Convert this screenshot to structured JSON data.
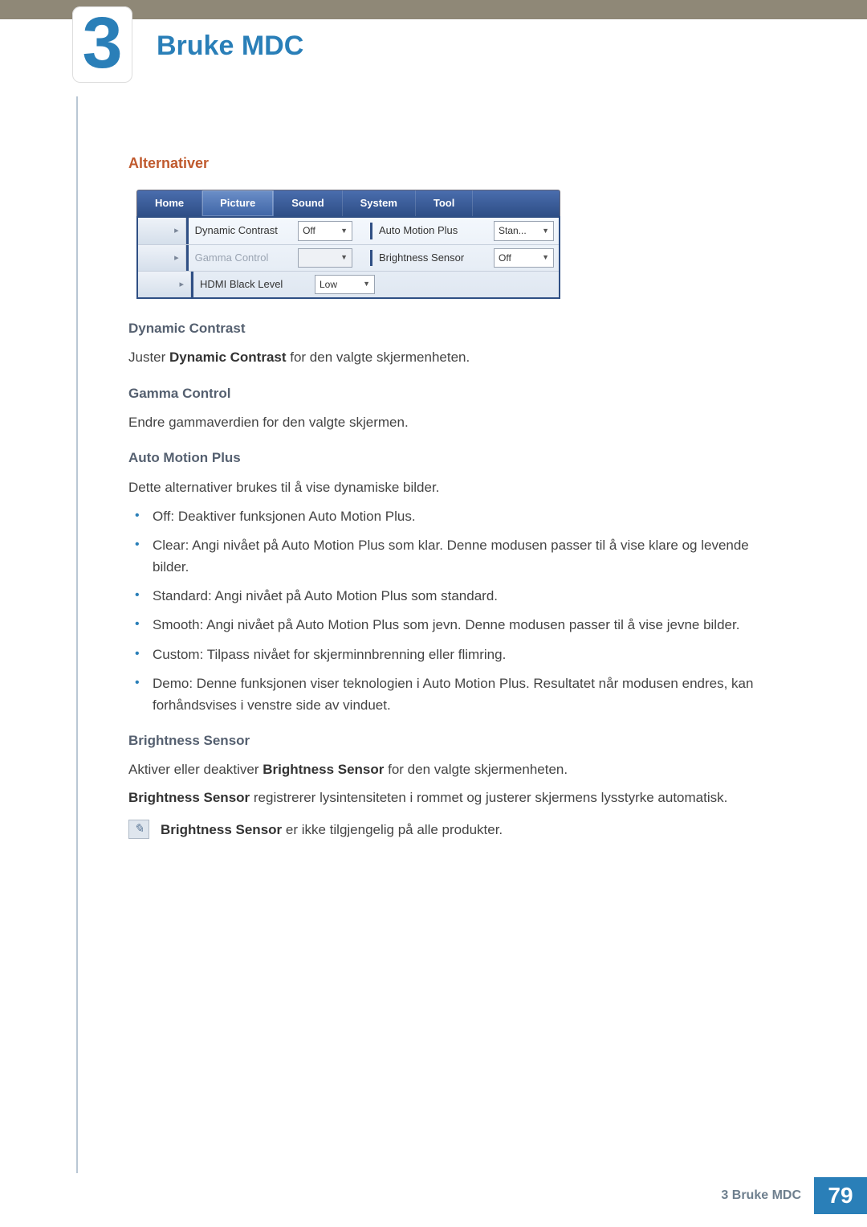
{
  "header": {
    "chapter_number": "3",
    "chapter_title": "Bruke MDC"
  },
  "section": {
    "title": "Alternativer"
  },
  "ui": {
    "tabs": [
      "Home",
      "Picture",
      "Sound",
      "System",
      "Tool"
    ],
    "active_tab": "Picture",
    "rows": [
      {
        "left_label": "Dynamic Contrast",
        "left_value": "Off",
        "left_disabled": false,
        "right_label": "Auto Motion Plus",
        "right_value": "Stan...",
        "right_disabled": false
      },
      {
        "left_label": "Gamma Control",
        "left_value": "",
        "left_disabled": true,
        "right_label": "Brightness Sensor",
        "right_value": "Off",
        "right_disabled": false
      },
      {
        "left_label": "HDMI Black Level",
        "left_value": "Low",
        "left_disabled": false,
        "right_label": "",
        "right_value": "",
        "right_disabled": false
      }
    ],
    "handle_glyph": "▸"
  },
  "dynamic_contrast": {
    "heading": "Dynamic Contrast",
    "text_pre": "Juster ",
    "text_bold": "Dynamic Contrast",
    "text_post": " for den valgte skjermenheten."
  },
  "gamma_control": {
    "heading": "Gamma Control",
    "text": "Endre gammaverdien for den valgte skjermen."
  },
  "auto_motion_plus": {
    "heading": "Auto Motion Plus",
    "intro": "Dette alternativer brukes til å vise dynamiske bilder.",
    "items": [
      {
        "b": "Off",
        "mid": ": Deaktiver funksjonen ",
        "b2": "Auto Motion Plus",
        "post": "."
      },
      {
        "b": "Clear",
        "mid": ": Angi nivået på ",
        "b2": "Auto Motion Plus",
        "post": " som klar. Denne modusen passer til å vise klare og levende bilder."
      },
      {
        "b": "Standard",
        "mid": ": Angi nivået på ",
        "b2": "Auto Motion Plus",
        "post": " som standard."
      },
      {
        "b": "Smooth",
        "mid": ": Angi nivået på ",
        "b2": "Auto Motion Plus",
        "post": " som jevn. Denne modusen passer til å vise jevne bilder."
      },
      {
        "b": "Custom",
        "mid": ": Tilpass nivået for skjerminnbrenning eller flimring.",
        "b2": "",
        "post": ""
      },
      {
        "b": "Demo",
        "mid": ": Denne funksjonen viser teknologien i ",
        "b2": "Auto Motion Plus",
        "post": ". Resultatet når modusen endres, kan forhåndsvises i venstre side av vinduet."
      }
    ]
  },
  "brightness_sensor": {
    "heading": "Brightness Sensor",
    "p1_pre": "Aktiver eller deaktiver ",
    "p1_b": "Brightness Sensor",
    "p1_post": " for den valgte skjermenheten.",
    "p2_b": "Brightness Sensor",
    "p2_post": " registrerer lysintensiteten i rommet og justerer skjermens lysstyrke automatisk.",
    "note_b": "Brightness Sensor",
    "note_post": " er ikke tilgjengelig på alle produkter."
  },
  "footer": {
    "label": "3 Bruke MDC",
    "page": "79"
  }
}
